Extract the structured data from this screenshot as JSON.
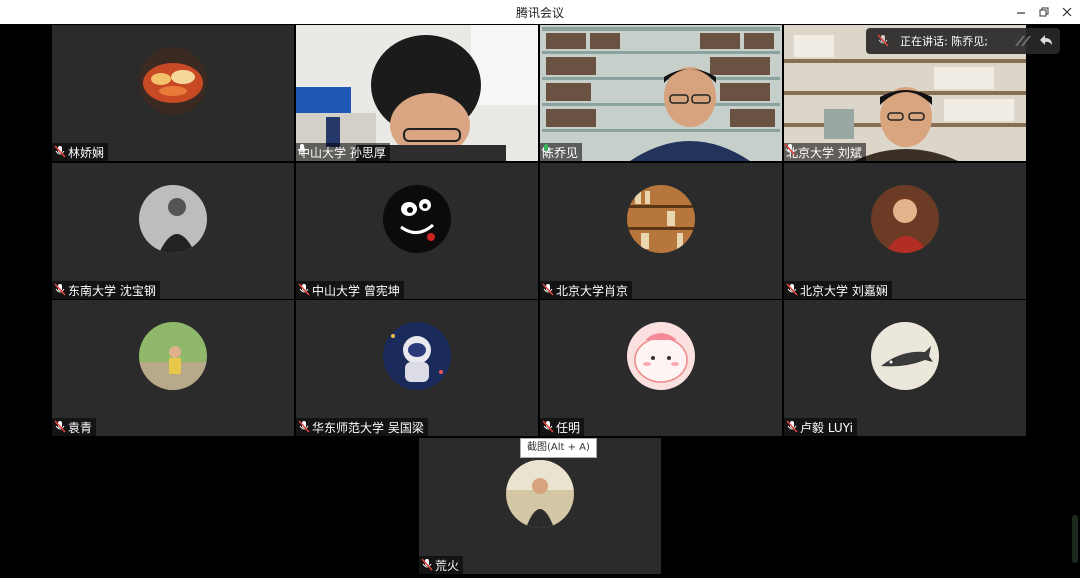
{
  "window": {
    "title": "腾讯会议"
  },
  "speaking_indicator": {
    "text": "正在讲话: 陈乔见;"
  },
  "tooltip": {
    "text": "截图(Alt + A)"
  },
  "participants": [
    {
      "name": "林娇娴",
      "mic": "muted"
    },
    {
      "name": "中山大学 孙思厚",
      "mic": "on"
    },
    {
      "name": "陈乔见",
      "mic": "speaking"
    },
    {
      "name": "北京大学 刘斌",
      "mic": "muted"
    },
    {
      "name": "东南大学 沈宝钢",
      "mic": "muted"
    },
    {
      "name": "中山大学 曾宪坤",
      "mic": "muted"
    },
    {
      "name": "北京大学肖京",
      "mic": "muted"
    },
    {
      "name": "北京大学 刘嘉娴",
      "mic": "muted"
    },
    {
      "name": "袁青",
      "mic": "muted"
    },
    {
      "name": "华东师范大学 吴国梁",
      "mic": "muted"
    },
    {
      "name": "任明",
      "mic": "muted"
    },
    {
      "name": "卢毅 LUYi",
      "mic": "muted"
    },
    {
      "name": "荒火",
      "mic": "muted"
    }
  ],
  "colors": {
    "tile_bg": "#2b2b2b",
    "active_border": "#33b35a",
    "muted_mic": "#e0443c",
    "speaking_mic": "#33b35a"
  }
}
